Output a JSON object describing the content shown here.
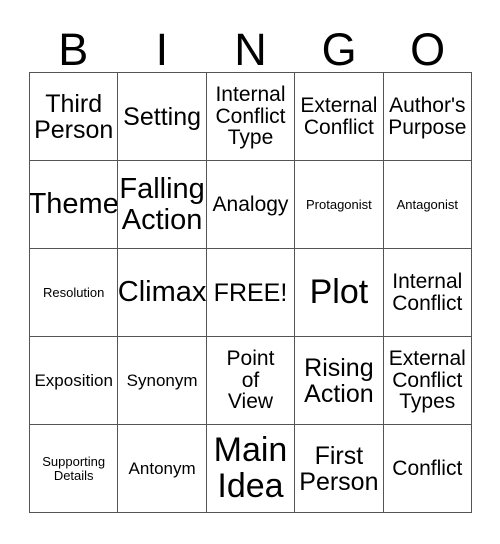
{
  "card": {
    "type": "bingo-card",
    "headers": [
      "B",
      "I",
      "N",
      "G",
      "O"
    ],
    "grid_size": "5x5",
    "free_space": "FREE!",
    "colors": {
      "background": "#ffffff",
      "text": "#000000",
      "border": "#555555"
    },
    "rows": [
      [
        {
          "text": "Third\nPerson",
          "size": "l"
        },
        {
          "text": "Setting",
          "size": "l"
        },
        {
          "text": "Internal\nConflict\nType",
          "size": "m"
        },
        {
          "text": "External\nConflict",
          "size": "m"
        },
        {
          "text": "Author's\nPurpose",
          "size": "m"
        }
      ],
      [
        {
          "text": "Theme",
          "size": "xl"
        },
        {
          "text": "Falling\nAction",
          "size": "xl"
        },
        {
          "text": "Analogy",
          "size": "m"
        },
        {
          "text": "Protagonist",
          "size": "xs"
        },
        {
          "text": "Antagonist",
          "size": "xs"
        }
      ],
      [
        {
          "text": "Resolution",
          "size": "xs"
        },
        {
          "text": "Climax",
          "size": "xl"
        },
        {
          "text": "FREE!",
          "size": "l"
        },
        {
          "text": "Plot",
          "size": "xxl"
        },
        {
          "text": "Internal\nConflict",
          "size": "m"
        }
      ],
      [
        {
          "text": "Exposition",
          "size": "s"
        },
        {
          "text": "Synonym",
          "size": "s"
        },
        {
          "text": "Point\nof\nView",
          "size": "m"
        },
        {
          "text": "Rising\nAction",
          "size": "l"
        },
        {
          "text": "External\nConflict\nTypes",
          "size": "m"
        }
      ],
      [
        {
          "text": "Supporting\nDetails",
          "size": "xs"
        },
        {
          "text": "Antonym",
          "size": "s"
        },
        {
          "text": "Main\nIdea",
          "size": "xxl"
        },
        {
          "text": "First\nPerson",
          "size": "l"
        },
        {
          "text": "Conflict",
          "size": "m"
        }
      ]
    ]
  }
}
